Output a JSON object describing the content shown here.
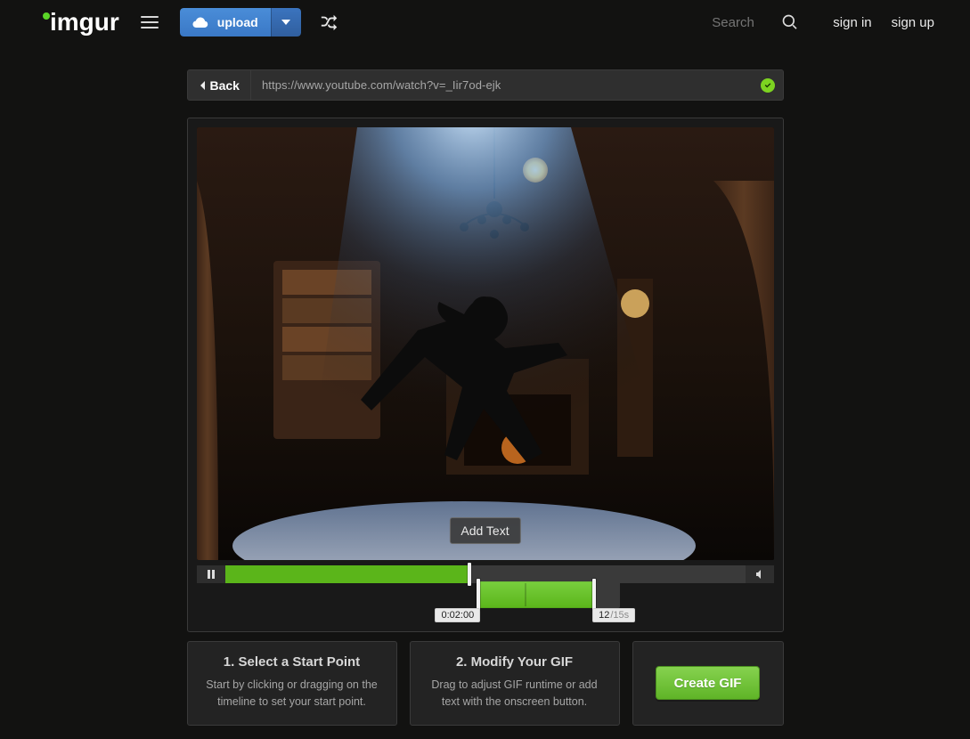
{
  "nav": {
    "logo_text": "imgur",
    "upload_label": "upload",
    "search_placeholder": "Search",
    "sign_in": "sign in",
    "sign_up": "sign up"
  },
  "bar": {
    "back_label": "Back",
    "url": "https://www.youtube.com/watch?v=_Iir7od-ejk"
  },
  "overlay": {
    "add_text": "Add Text"
  },
  "timeline": {
    "progress_percent": 47,
    "sel_left_percent_of_progress": 48.8,
    "sel_width_percent_of_progress": 22.2,
    "dark_width_percent_of_progress": 5.0,
    "start_chip": "0:02:00",
    "end_value": "12",
    "end_suffix": "/15s"
  },
  "steps": {
    "s1_title": "1. Select a Start Point",
    "s1_desc": "Start by clicking or dragging on the timeline to set your start point.",
    "s2_title": "2. Modify Your GIF",
    "s2_desc": "Drag to adjust GIF runtime or add text with the onscreen button.",
    "cta": "Create GIF"
  }
}
